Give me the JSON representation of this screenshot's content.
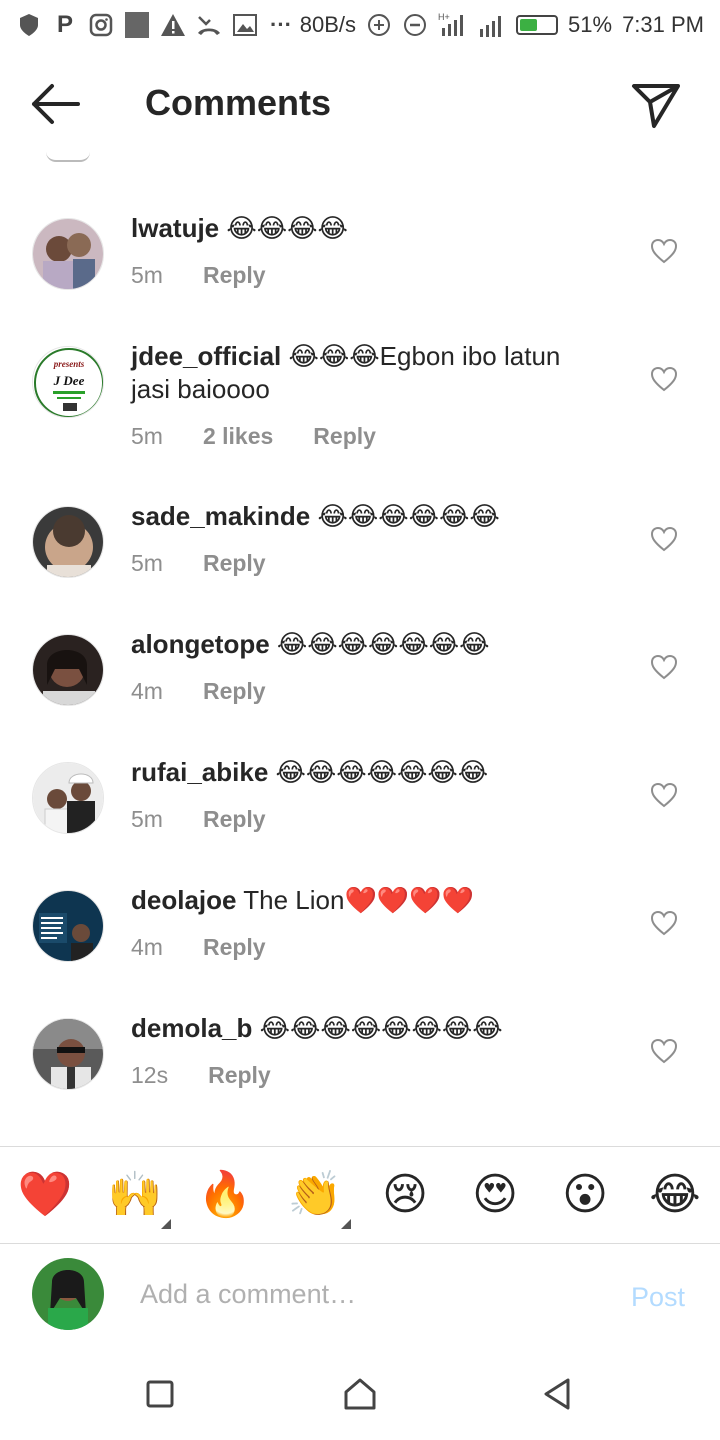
{
  "status_bar": {
    "network_speed": "80B/s",
    "battery": "51%",
    "battery_level": 0.51,
    "time": "7:31 PM",
    "signal_label": "H+"
  },
  "header": {
    "title": "Comments"
  },
  "comments": [
    {
      "username": "lwatuje",
      "text": "",
      "emoji": "😂😂😂😂",
      "time": "5m",
      "likes": "",
      "reply": "Reply"
    },
    {
      "username": "jdee_official",
      "text": "Egbon ibo latun jasi baioooo",
      "emoji": "😂😂😂",
      "time": "5m",
      "likes": "2 likes",
      "reply": "Reply",
      "avatar_text": {
        "line1": "presents",
        "line2": "J Dee"
      }
    },
    {
      "username": "sade_makinde",
      "text": "",
      "emoji": "😂😂😂😂😂😂",
      "time": "5m",
      "likes": "",
      "reply": "Reply"
    },
    {
      "username": "alongetope",
      "text": "",
      "emoji": "😂😂😂😂😂😂😂",
      "time": "4m",
      "likes": "",
      "reply": "Reply"
    },
    {
      "username": "rufai_abike",
      "text": "",
      "emoji": "😂😂😂😂😂😂😂",
      "time": "5m",
      "likes": "",
      "reply": "Reply"
    },
    {
      "username": "deolajoe",
      "text": "The Lion",
      "emoji": "❤️❤️❤️❤️",
      "time": "4m",
      "likes": "",
      "reply": "Reply"
    },
    {
      "username": "demola_b",
      "text": "",
      "emoji": "😂😂😂😂😂😂😂😂",
      "time": "12s",
      "likes": "",
      "reply": "Reply"
    }
  ],
  "reactions": [
    "❤️",
    "🙌",
    "🔥",
    "👏",
    "😢",
    "😍",
    "😮",
    "😂"
  ],
  "composer": {
    "placeholder": "Add a comment…",
    "post_label": "Post"
  },
  "colors": {
    "text": "#262626",
    "secondary": "#8e8e8e",
    "post_disabled": "#b3dbff",
    "heart": "#e0245e"
  }
}
